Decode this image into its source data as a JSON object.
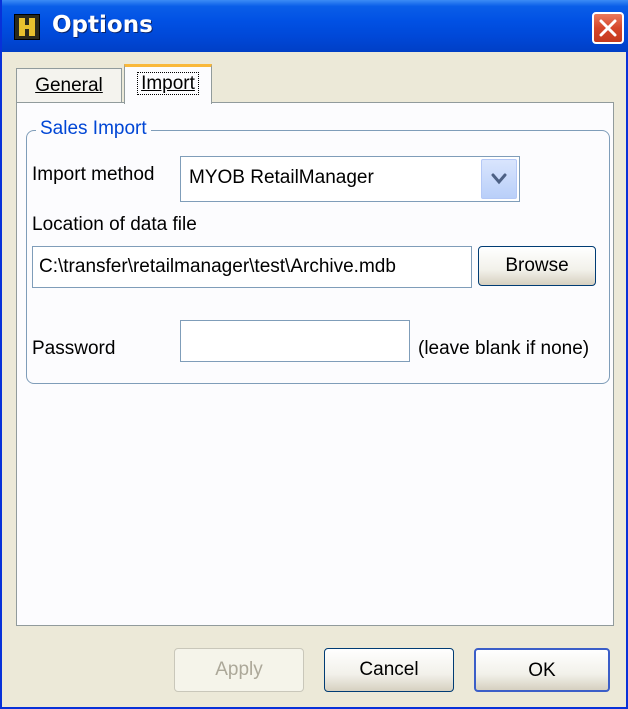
{
  "window": {
    "title": "Options",
    "icon": "app-icon",
    "close_icon": "close-icon"
  },
  "tabs": [
    {
      "label": "General",
      "active": false
    },
    {
      "label": "Import",
      "active": true
    }
  ],
  "sales_import": {
    "group_label": "Sales Import",
    "import_method_label": "Import method",
    "import_method_value": "MYOB RetailManager",
    "location_label": "Location of data file",
    "location_value": "C:\\transfer\\retailmanager\\test\\Archive.mdb",
    "browse_label": "Browse",
    "password_label": "Password",
    "password_value": "",
    "password_hint": "(leave blank if none)"
  },
  "buttons": {
    "apply": "Apply",
    "cancel": "Cancel",
    "ok": "OK"
  },
  "colors": {
    "titlebar": "#0151e4",
    "accent": "#f9b83a",
    "group_label": "#0046d5"
  }
}
